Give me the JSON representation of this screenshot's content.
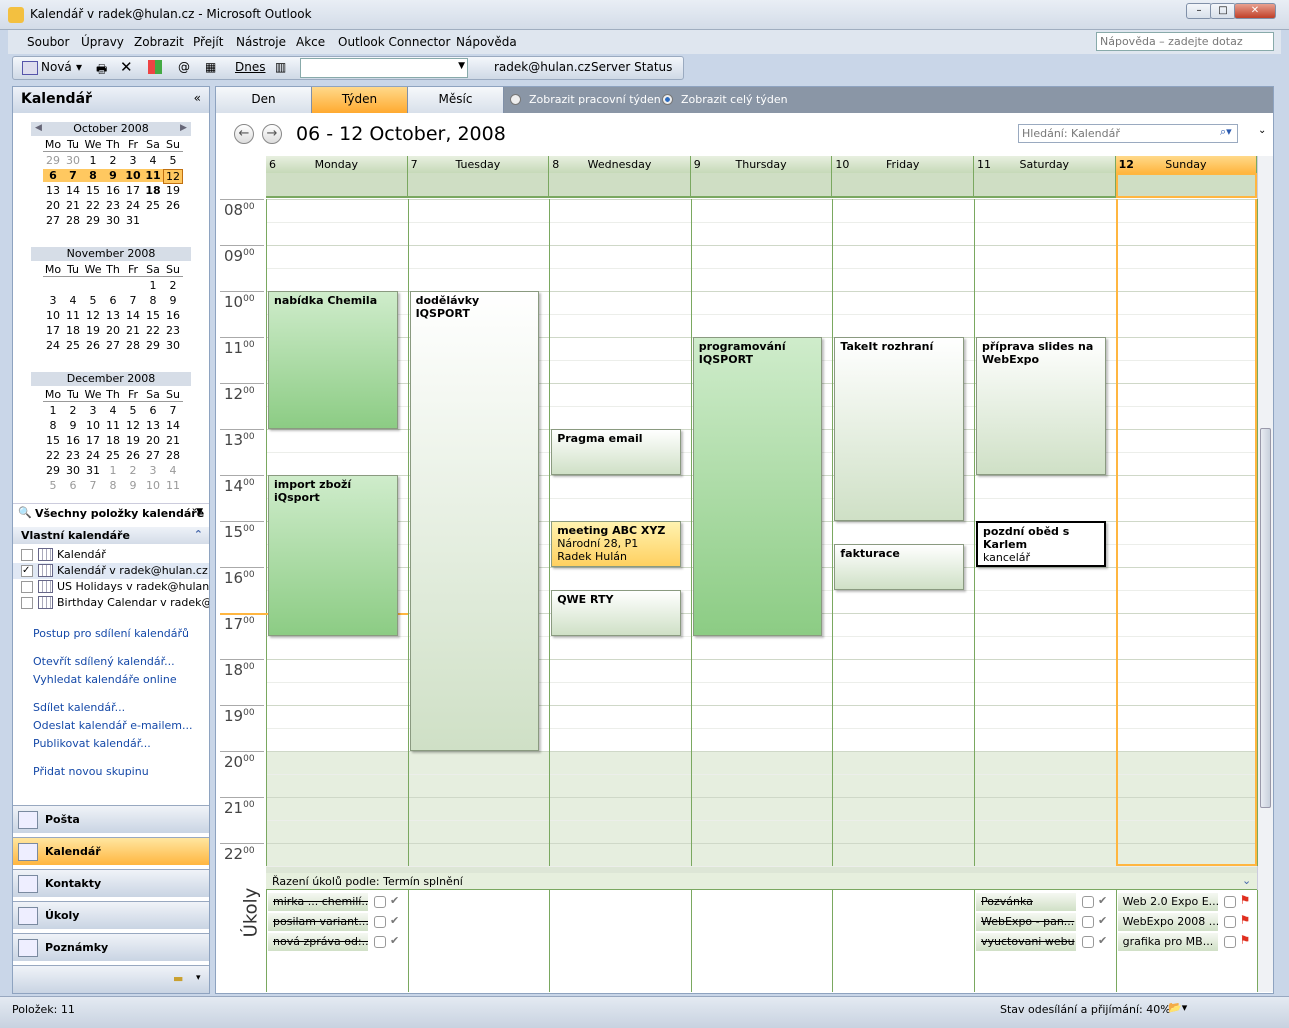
{
  "window": {
    "title": "Kalendář v radek@hulan.cz - Microsoft Outlook",
    "min": "–",
    "max": "□",
    "close": "✕"
  },
  "menu": [
    "Soubor",
    "Úpravy",
    "Zobrazit",
    "Přejít",
    "Nástroje",
    "Akce",
    "Outlook Connector",
    "Nápověda"
  ],
  "help_placeholder": "Nápověda – zadejte dotaz",
  "toolbar": {
    "new": "Nová",
    "today": "Dnes",
    "account": "radek@hulan.cz",
    "server_status": "Server Status"
  },
  "left": {
    "title": "Kalendář",
    "collapse": "«",
    "weekday_headers": [
      "Mo",
      "Tu",
      "We",
      "Th",
      "Fr",
      "Sa",
      "Su"
    ],
    "months": [
      {
        "name": "October 2008",
        "weeks": [
          [
            29,
            30,
            1,
            2,
            3,
            4,
            5
          ],
          [
            6,
            7,
            8,
            9,
            10,
            11,
            12
          ],
          [
            13,
            14,
            15,
            16,
            17,
            18,
            19
          ],
          [
            20,
            21,
            22,
            23,
            24,
            25,
            26
          ],
          [
            27,
            28,
            29,
            30,
            31
          ]
        ]
      },
      {
        "name": "November 2008",
        "weeks": [
          [
            null,
            null,
            null,
            null,
            null,
            1,
            2
          ],
          [
            3,
            4,
            5,
            6,
            7,
            8,
            9
          ],
          [
            10,
            11,
            12,
            13,
            14,
            15,
            16
          ],
          [
            17,
            18,
            19,
            20,
            21,
            22,
            23
          ],
          [
            24,
            25,
            26,
            27,
            28,
            29,
            30
          ]
        ]
      },
      {
        "name": "December 2008",
        "weeks": [
          [
            1,
            2,
            3,
            4,
            5,
            6,
            7
          ],
          [
            8,
            9,
            10,
            11,
            12,
            13,
            14
          ],
          [
            15,
            16,
            17,
            18,
            19,
            20,
            21
          ],
          [
            22,
            23,
            24,
            25,
            26,
            27,
            28
          ],
          [
            29,
            30,
            31,
            1,
            2,
            3,
            4
          ],
          [
            5,
            6,
            7,
            8,
            9,
            10,
            11
          ]
        ]
      }
    ],
    "all_items": "Všechny položky kalendáře",
    "my_calendars": "Vlastní kalendáře",
    "calendars": [
      {
        "name": "Kalendář",
        "checked": false
      },
      {
        "name": "Kalendář v radek@hulan.cz",
        "checked": true
      },
      {
        "name": "US Holidays v radek@hulan.cz",
        "checked": false
      },
      {
        "name": "Birthday Calendar v radek@hulan.cz",
        "checked": false
      }
    ],
    "links": [
      "Postup pro sdílení kalendářů",
      "Otevřít sdílený kalendář...",
      "Vyhledat kalendáře online",
      "Sdílet kalendář...",
      "Odeslat kalendář e-mailem...",
      "Publikovat kalendář...",
      "Přidat novou skupinu"
    ],
    "nav": [
      {
        "label": "Pošta"
      },
      {
        "label": "Kalendář",
        "selected": true
      },
      {
        "label": "Kontakty"
      },
      {
        "label": "Úkoly"
      },
      {
        "label": "Poznámky"
      }
    ]
  },
  "view": {
    "tabs": [
      "Den",
      "Týden",
      "Měsíc"
    ],
    "active_tab": "Týden",
    "work_week": "Zobrazit pracovní týden",
    "full_week": "Zobrazit celý týden",
    "selected_option": "full_week",
    "date_range": "06 - 12 October, 2008",
    "search_placeholder": "Hledání: Kalendář"
  },
  "days": [
    {
      "num": "6",
      "name": "Monday"
    },
    {
      "num": "7",
      "name": "Tuesday"
    },
    {
      "num": "8",
      "name": "Wednesday"
    },
    {
      "num": "9",
      "name": "Thursday"
    },
    {
      "num": "10",
      "name": "Friday"
    },
    {
      "num": "11",
      "name": "Saturday"
    },
    {
      "num": "12",
      "name": "Sunday",
      "today": true
    }
  ],
  "hours": [
    "08",
    "09",
    "10",
    "11",
    "12",
    "13",
    "14",
    "15",
    "16",
    "17",
    "18",
    "19",
    "20",
    "21",
    "22"
  ],
  "minutes": "00",
  "events": [
    {
      "day": 0,
      "start": 10,
      "end": 13,
      "title": "nabídka Chemila",
      "style": "green"
    },
    {
      "day": 0,
      "start": 14,
      "end": 17.5,
      "title": "import zboží iQsport",
      "style": "green"
    },
    {
      "day": 1,
      "start": 10,
      "end": 20,
      "title": "dodělávky IQSPORT",
      "style": "white"
    },
    {
      "day": 2,
      "start": 13,
      "end": 14,
      "title": "Pragma email",
      "style": "white"
    },
    {
      "day": 2,
      "start": 15,
      "end": 16,
      "title": "meeting ABC XYZ",
      "lines": [
        "Národní 28, P1",
        "Radek Hulán"
      ],
      "style": "yellow"
    },
    {
      "day": 2,
      "start": 16.5,
      "end": 17.5,
      "title": "QWE RTY",
      "style": "white"
    },
    {
      "day": 3,
      "start": 11,
      "end": 17.5,
      "title": "programování IQSPORT",
      "style": "green"
    },
    {
      "day": 4,
      "start": 11,
      "end": 15,
      "title": "TakeIt rozhraní",
      "style": "white"
    },
    {
      "day": 4,
      "start": 15.5,
      "end": 16.5,
      "title": "fakturace",
      "style": "white"
    },
    {
      "day": 5,
      "start": 11,
      "end": 14,
      "title": "příprava slides na WebExpo",
      "style": "white"
    },
    {
      "day": 5,
      "start": 15,
      "end": 16,
      "title": "pozdní oběd s Karlem",
      "lines": [
        "kancelář"
      ],
      "style": "sel"
    }
  ],
  "tasks": {
    "label": "Úkoly",
    "sort": "Řazení úkolů podle: Termín splnění",
    "items": [
      {
        "day": 0,
        "title": "mirka ... chemilí...",
        "done": true
      },
      {
        "day": 0,
        "title": "posilam variant...",
        "done": true
      },
      {
        "day": 0,
        "title": "nová zpráva od:...",
        "done": true
      },
      {
        "day": 5,
        "title": "Pozvánka",
        "done": true
      },
      {
        "day": 5,
        "title": "WebExpo - pan...",
        "done": true
      },
      {
        "day": 5,
        "title": "vyuctovani webu",
        "done": true
      },
      {
        "day": 6,
        "title": "Web 2.0 Expo E...",
        "done": false
      },
      {
        "day": 6,
        "title": "WebExpo 2008 ...",
        "done": false
      },
      {
        "day": 6,
        "title": "grafika pro MB...",
        "done": false
      }
    ]
  },
  "status": {
    "items": "Položek: 11",
    "sync": "Stav odesílání a přijímání: 40%"
  },
  "colors": {
    "accent": "#ffb640",
    "grid": "#7aa860",
    "link": "#1549a8"
  }
}
